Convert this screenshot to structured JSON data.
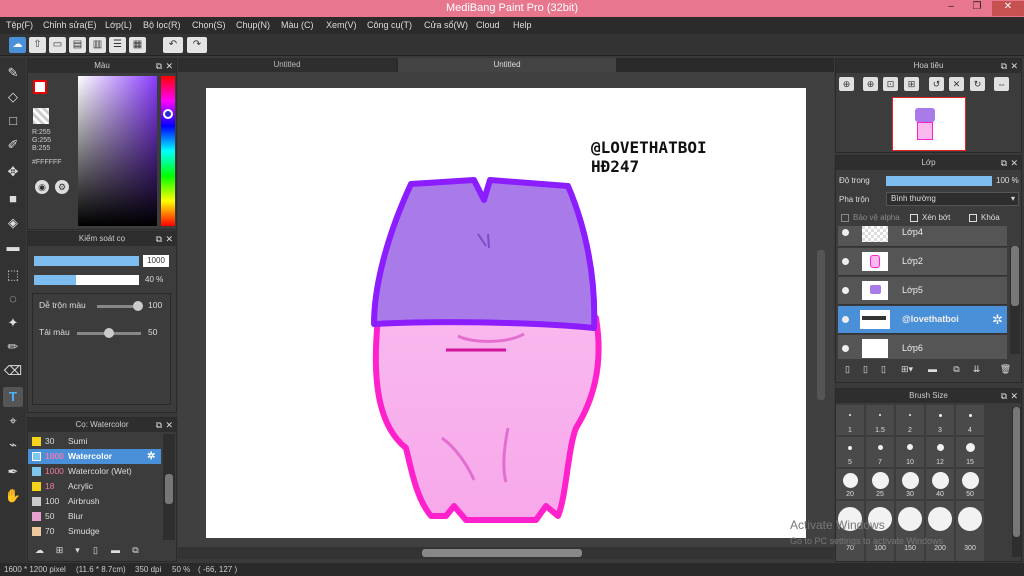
{
  "window": {
    "title": "MediBang Paint Pro (32bit)",
    "minimize": "–",
    "restore": "❐",
    "close": "✕"
  },
  "menu": [
    "Tệp(F)",
    "Chỉnh sửa(E)",
    "Lớp(L)",
    "Bộ lọc(R)",
    "Chọn(S)",
    "Chụp(N)",
    "Màu (C)",
    "Xem(V)",
    "Công cụ(T)",
    "Cửa sổ(W)",
    "Cloud",
    "Help"
  ],
  "tabs": [
    "Untitled",
    "Untitled"
  ],
  "color_panel": {
    "title": "Màu",
    "r": "R:255",
    "g": "G:255",
    "b": "B:255",
    "hex": "#FFFFFF"
  },
  "brush_control": {
    "title": "Kiểm soát cọ",
    "size_value": "1000",
    "opacity_value": "40 %",
    "blend_label": "Dễ trộn màu",
    "blend_value": "100",
    "load_label": "Tải màu",
    "load_value": "50"
  },
  "brush_list": {
    "title": "Cọ: Watercolor",
    "items": [
      {
        "size": "30",
        "name": "Sumi",
        "color": "#f5d31a"
      },
      {
        "size": "1000",
        "name": "Watercolor",
        "color": "#7ec8f0"
      },
      {
        "size": "1000",
        "name": "Watercolor (Wet)",
        "color": "#7ec8f0"
      },
      {
        "size": "18",
        "name": "Acrylic",
        "color": "#f5d31a"
      },
      {
        "size": "100",
        "name": "Airbrush",
        "color": "#cccccc"
      },
      {
        "size": "50",
        "name": "Blur",
        "color": "#e8a0d0"
      },
      {
        "size": "70",
        "name": "Smudge",
        "color": "#f0c8a0"
      }
    ]
  },
  "artwork": {
    "caption_line1": "@LOVETHATBOI",
    "caption_line2": "HĐ247"
  },
  "navigator": {
    "title": "Hoa tiêu"
  },
  "layer_panel": {
    "title": "Lớp",
    "opacity_label": "Độ trong",
    "opacity_value": "100 %",
    "blend_label": "Pha trộn",
    "blend_value": "Bình thường",
    "protect_alpha": "Bảo vệ alpha",
    "clipping": "Xén bớt",
    "lock": "Khóa",
    "layers": [
      {
        "name": "Lớp4"
      },
      {
        "name": "Lớp2"
      },
      {
        "name": "Lớp5"
      },
      {
        "name": "@lovethatboi"
      },
      {
        "name": "Lớp6"
      }
    ]
  },
  "brush_size": {
    "title": "Brush Size",
    "sizes": [
      "1",
      "1.5",
      "2",
      "3",
      "4",
      "5",
      "7",
      "10",
      "12",
      "15",
      "20",
      "25",
      "30",
      "40",
      "50",
      "70",
      "100",
      "150",
      "200",
      "300"
    ]
  },
  "watermark": {
    "line1": "Activate Windows",
    "line2": "Go to PC settings to activate Windows"
  },
  "status": {
    "dims": "1600 * 1200 pixel",
    "physical": "(11.6 * 8.7cm)",
    "dpi": "350 dpi",
    "zoom": "50 %",
    "coords": "( -66, 127 )"
  }
}
